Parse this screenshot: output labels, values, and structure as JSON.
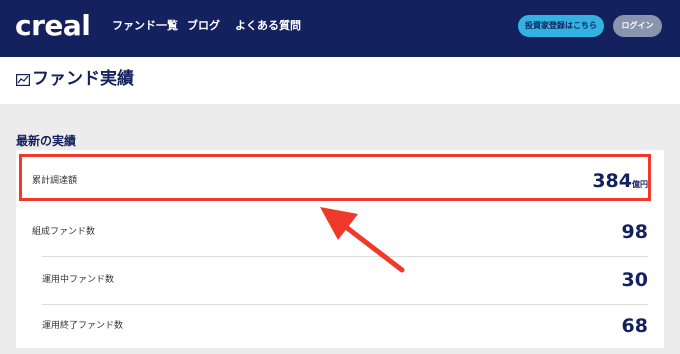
{
  "header": {
    "logo": "creal",
    "nav": [
      "ファンド一覧",
      "ブログ",
      "よくある質問"
    ],
    "register_button": "投資家登録はこちら",
    "login_button": "ログイン"
  },
  "page": {
    "title": "ファンド実績",
    "title_icon": "chart-icon"
  },
  "section": {
    "heading": "最新の実績",
    "rows": [
      {
        "label": "累計調達額",
        "value": "384",
        "unit": "億円"
      },
      {
        "label": "組成ファンド数",
        "value": "98",
        "unit": ""
      },
      {
        "label": "運用中ファンド数",
        "value": "30",
        "unit": ""
      },
      {
        "label": "運用終了ファンド数",
        "value": "68",
        "unit": ""
      }
    ]
  },
  "annotation": {
    "highlight_color": "#f0382b"
  },
  "colors": {
    "navy": "#13215e",
    "accent_blue": "#33b1e0",
    "login_gray": "#8a95ad"
  }
}
